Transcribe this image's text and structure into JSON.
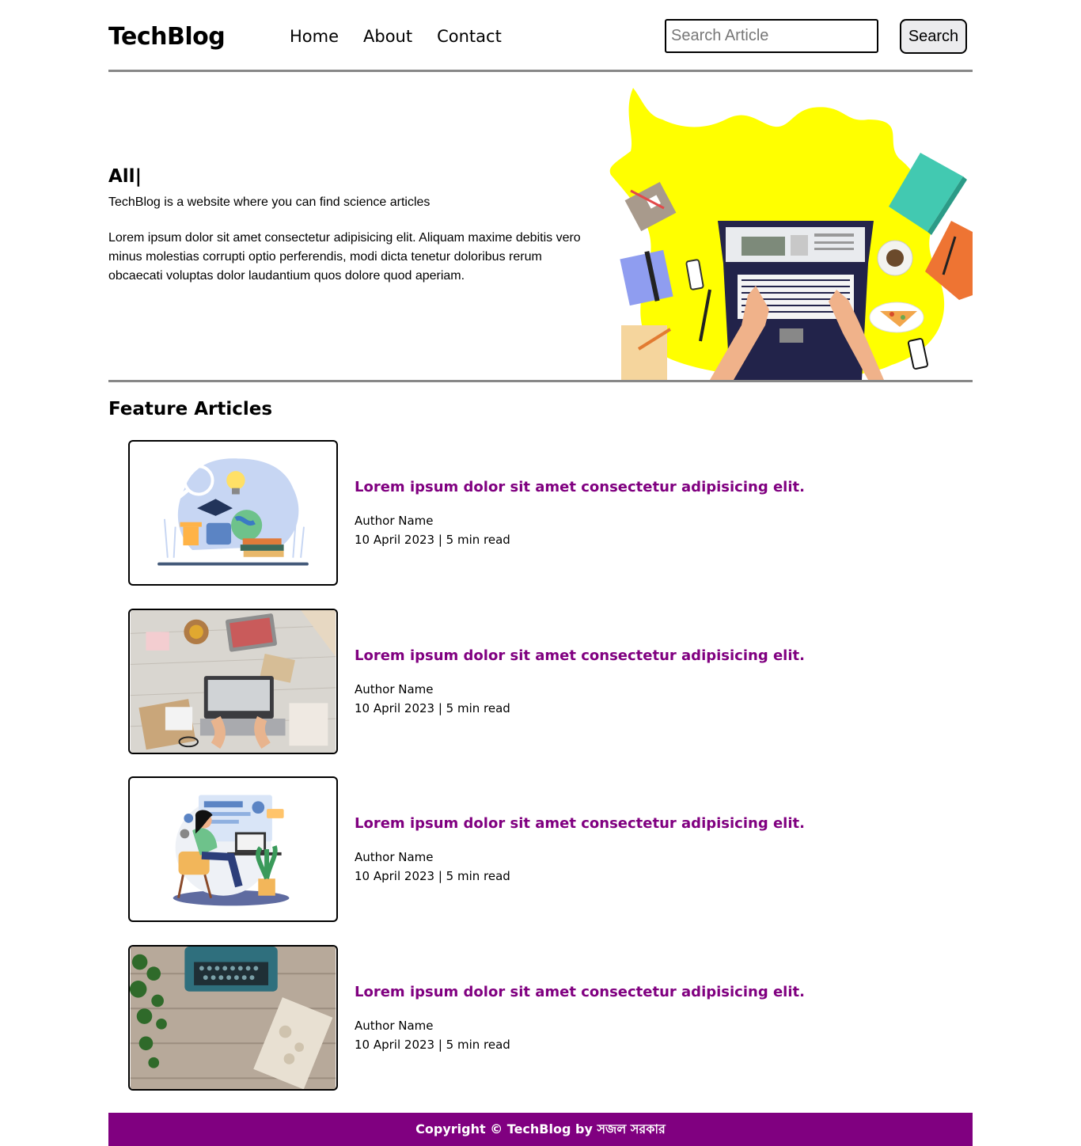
{
  "header": {
    "logo": "TechBlog",
    "nav": [
      {
        "label": "Home"
      },
      {
        "label": "About"
      },
      {
        "label": "Contact"
      }
    ],
    "search_placeholder": "Search Article",
    "search_button": "Search"
  },
  "hero": {
    "title": "All|",
    "tagline": "TechBlog is a website where you can find science articles",
    "body": "Lorem ipsum dolor sit amet consectetur adipisicing elit. Aliquam maxime debitis vero minus molestias corrupti optio perferendis, modi dicta tenetur doloribus rerum obcaecati voluptas dolor laudantium quos dolore quod aperiam.",
    "illustration_icon": "laptop-desk-illustration"
  },
  "features": {
    "title": "Feature Articles",
    "articles": [
      {
        "title": "Lorem ipsum dolor sit amet consectetur adipisicing elit.",
        "author": "Author Name",
        "meta": "10 April 2023 | 5 min read",
        "thumb_icon": "education-illustration"
      },
      {
        "title": "Lorem ipsum dolor sit amet consectetur adipisicing elit.",
        "author": "Author Name",
        "meta": "10 April 2023 | 5 min read",
        "thumb_icon": "workspace-photo"
      },
      {
        "title": "Lorem ipsum dolor sit amet consectetur adipisicing elit.",
        "author": "Author Name",
        "meta": "10 April 2023 | 5 min read",
        "thumb_icon": "developer-illustration"
      },
      {
        "title": "Lorem ipsum dolor sit amet consectetur adipisicing elit.",
        "author": "Author Name",
        "meta": "10 April 2023 | 5 min read",
        "thumb_icon": "typewriter-photo"
      }
    ]
  },
  "footer": {
    "text": "Copyright © TechBlog by সজল সরকার"
  },
  "colors": {
    "accent": "#800080",
    "divider": "#888888",
    "hero_blob": "#ffff00"
  }
}
